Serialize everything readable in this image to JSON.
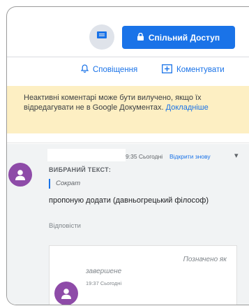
{
  "toolbar": {
    "share_label": "Спільний Доступ",
    "chat_icon": "chat-icon",
    "lock_icon": "lock-icon"
  },
  "actions": {
    "notifications_label": "Сповіщення",
    "comment_label": "Коментувати"
  },
  "banner": {
    "text": "Неактивні коментарі може бути вилучено, якщо їх відредагувати не в Google Документах.",
    "link": "Докладніше"
  },
  "comment": {
    "time": "9:35 Сьогодні",
    "reopen_label": "Відкрити знову",
    "selected_label": "ВИБРАНИЙ ТЕКСТ:",
    "quote": "Сократ",
    "body": "пропоную додати (давньогрецький філософ)",
    "reply_label": "Відповісти",
    "status_part1": "Позначено як",
    "status_part2": "завершене",
    "status_time": "19:37 Сьогодні"
  },
  "colors": {
    "accent": "#1a73e8",
    "avatar": "#8e4ba8",
    "banner": "#fdefc3"
  }
}
